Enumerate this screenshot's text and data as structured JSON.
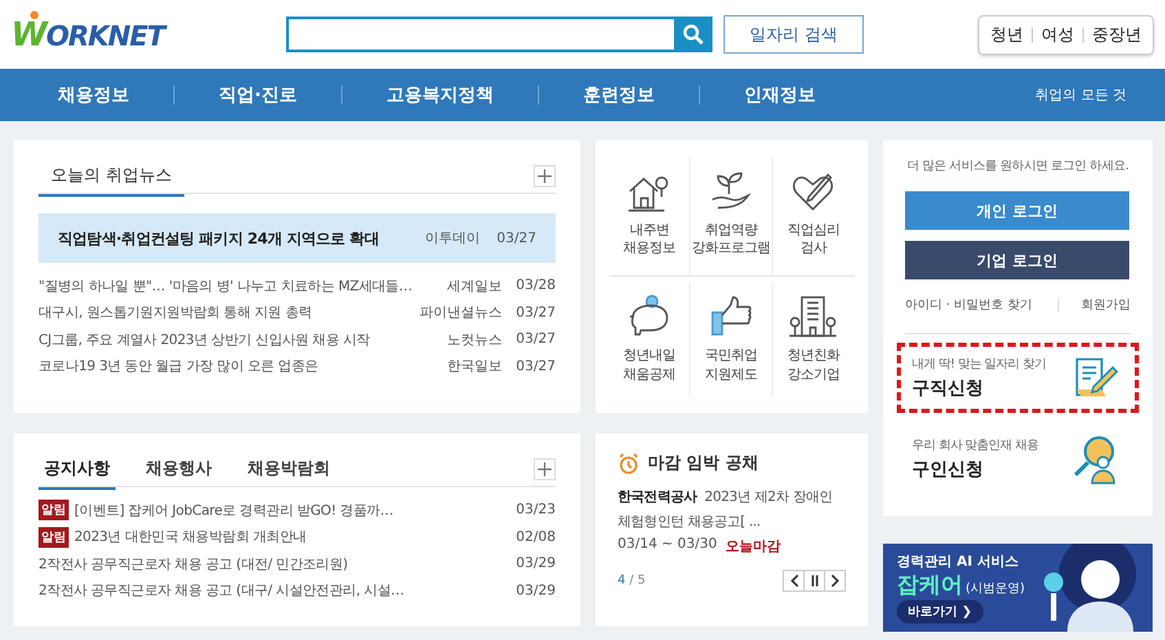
{
  "header": {
    "logo": "WORKNET",
    "search_button": "일자리 검색",
    "audience": [
      "청년",
      "여성",
      "중장년"
    ]
  },
  "nav": {
    "items": [
      "채용정보",
      "직업·진로",
      "고용복지정책",
      "훈련정보",
      "인재정보"
    ],
    "extra": "취업의 모든 것"
  },
  "news": {
    "tabs": [
      {
        "label": "오늘의 취업뉴스",
        "selected": true
      }
    ],
    "headline": {
      "title": "직업탐색·취업컨설팅 패키지 24개 지역으로 확대",
      "source": "이투데이",
      "date": "03/27"
    },
    "rows": [
      {
        "title": "\"질병의 하나일 뿐\"… '마음의 병' 나누고 치료하는 MZ세대들…",
        "source": "세계일보",
        "date": "03/28"
      },
      {
        "title": "대구시, 원스톱기원지원박람회 통해 지원 총력",
        "source": "파이낸셜뉴스",
        "date": "03/27"
      },
      {
        "title": "CJ그룹, 주요 계열사 2023년 상반기 신입사원 채용 시작",
        "source": "노컷뉴스",
        "date": "03/27"
      },
      {
        "title": "코로나19 3년 동안 월급 가장 많이 오른 업종은",
        "source": "한국일보",
        "date": "03/27"
      }
    ]
  },
  "notices": {
    "tabs": [
      {
        "label": "공지사항",
        "selected": true
      },
      {
        "label": "채용행사",
        "selected": false
      },
      {
        "label": "채용박람회",
        "selected": false
      }
    ],
    "rows": [
      {
        "badge": "알림",
        "title": "[이벤트] 잡케어 JobCare로 경력관리 받GO! 경품까…",
        "date": "03/23"
      },
      {
        "badge": "알림",
        "title": "2023년 대한민국 채용박람회 개최안내",
        "date": "02/08"
      },
      {
        "title": "2작전사 공무직근로자 채용 공고 (대전/ 민간조리원)",
        "date": "03/29"
      },
      {
        "title": "2작전사 공무직근로자 채용 공고 (대구/ 시설안전관리, 시설…",
        "date": "03/29"
      }
    ]
  },
  "services": [
    {
      "kind": "house",
      "label": "내주변\n채용정보"
    },
    {
      "kind": "sprout",
      "label": "취업역량\n강화프로그램"
    },
    {
      "kind": "heart",
      "label": "직업심리\n검사"
    },
    {
      "kind": "piggy",
      "label": "청년내일\n채움공제"
    },
    {
      "kind": "thumb",
      "label": "국민취업\n지원제도"
    },
    {
      "kind": "building",
      "label": "청년친화\n강소기업"
    }
  ],
  "deadline": {
    "title": "마감 임박 공채",
    "company": "한국전력공사",
    "job": "2023년 제2차 장애인 체험형인턴 채용공고[ ...",
    "period": "03/14 ~ 03/30",
    "status": "오늘마감",
    "page_current": "4",
    "page_total": "/ 5"
  },
  "login": {
    "prompt": "더 많은 서비스를 원하시면 로그인 하세요.",
    "personal": "개인 로그인",
    "company": "기업 로그인",
    "find": "아이디 · 비밀번호 찾기",
    "join": "회원가입",
    "links": [
      {
        "kind": "seeker",
        "sub": "내게 딱! 맞는 일자리 찾기",
        "title": "구직신청",
        "highlighted": true
      },
      {
        "kind": "employer",
        "sub": "우리 회사 맞춤인재 채용",
        "title": "구인신청",
        "highlighted": false
      }
    ]
  },
  "banner": {
    "line1": "경력관리 AI 서비스",
    "brand": "잡케어",
    "note": "(시범운영)",
    "button": "바로가기 ❯"
  }
}
